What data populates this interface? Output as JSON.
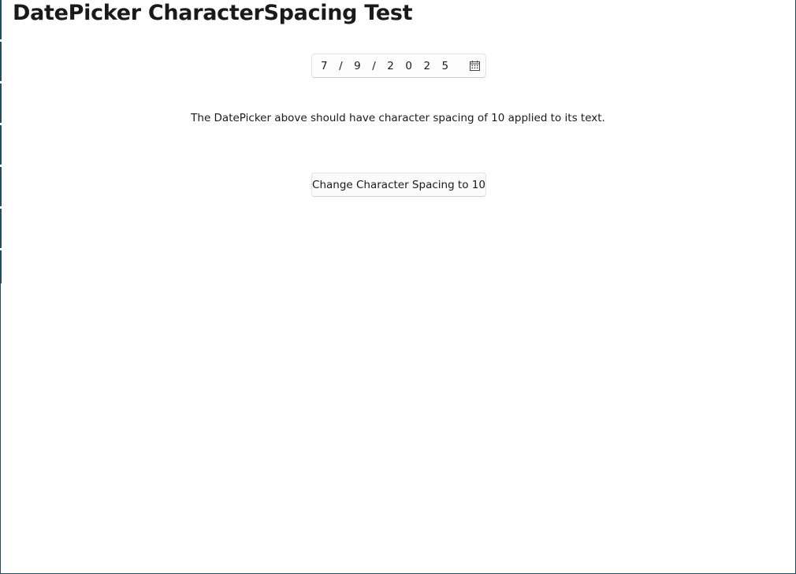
{
  "page": {
    "title": "DatePicker CharacterSpacing Test"
  },
  "datepicker": {
    "value": "7/9/2025",
    "icon": "calendar-icon"
  },
  "description": {
    "text": "The DatePicker above should have character spacing of 10 applied to its text."
  },
  "actions": {
    "change_spacing_label": "Change Character Spacing to 10"
  },
  "colors": {
    "window_border": "#1f4d66",
    "control_border": "#e3e3e3",
    "control_background": "#fbfbfb",
    "text": "#1a1a1a"
  }
}
